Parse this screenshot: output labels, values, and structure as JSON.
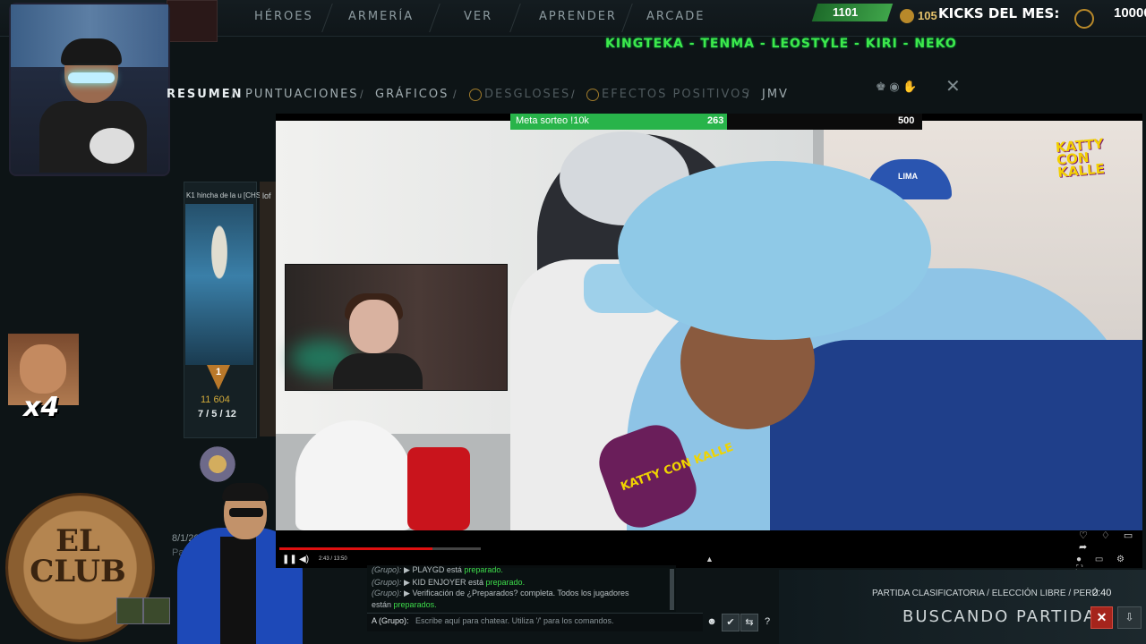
{
  "topnav": {
    "items": [
      "HÉROES",
      "ARMERÍA",
      "VER",
      "APRENDER",
      "ARCADE"
    ],
    "mmr_value": "1101",
    "gold_value": "105",
    "kicks_label": "KICKS DEL MES:",
    "kicks_value": "10000"
  },
  "overlay": {
    "winners": "KINGTEKA - TENMA - LEOSTYLE - KIRI - NEKO",
    "emote_count": "x4",
    "club_logo_text": "EL CLUB"
  },
  "postgame": {
    "tabs": [
      "RESUMEN",
      "PUNTUACIONES",
      "GRÁFICOS",
      "DESGLOSES",
      "EFECTOS POSITIVOS",
      "JMV"
    ],
    "player_name": "K1 hincha de la u [CHSA]",
    "player2_name": "lof",
    "net_worth": "11 604",
    "kda": "7 / 5 / 12",
    "rank_number": "1",
    "date": "8/1/2026 12",
    "date_sub": "Part"
  },
  "stream_goal": {
    "label": "Meta sorteo !10k",
    "current": "263",
    "target": "500",
    "progress": 0.526
  },
  "video": {
    "cap_text": "LIMA",
    "mic_text": "KATTY CON KALLE",
    "channel_logo": "KATTY CON KALLE",
    "time_text": "2:43 / 13:50",
    "progress": 0.76
  },
  "chat": {
    "lines": [
      {
        "group": "(Grupo):",
        "arrow": "▶",
        "name": "PLAYGD",
        "text": "está",
        "status": "preparado."
      },
      {
        "group": "(Grupo):",
        "arrow": "▶",
        "name": "KID ENJOYER",
        "text": "está",
        "status": "preparado."
      },
      {
        "group": "(Grupo):",
        "arrow": "▶",
        "name": "Verificación de",
        "text": "¿Preparados? completa. Todos los jugadores",
        "status": ""
      },
      {
        "group": "",
        "arrow": "",
        "name": "están",
        "text": "",
        "status": "preparados."
      }
    ],
    "input_prefix": "A (Grupo):",
    "input_placeholder": "Escribe aquí para chatear. Utiliza '/' para los comandos."
  },
  "matchmaking": {
    "mode": "PARTIDA CLASIFICATORIA / ELECCIÓN LIBRE / PERÚ",
    "time": "2:40",
    "title": "BUSCANDO PARTIDA"
  },
  "colors": {
    "accent_green": "#3ee84b",
    "goal_green": "#28b44a",
    "cancel_red": "#a5241c"
  }
}
